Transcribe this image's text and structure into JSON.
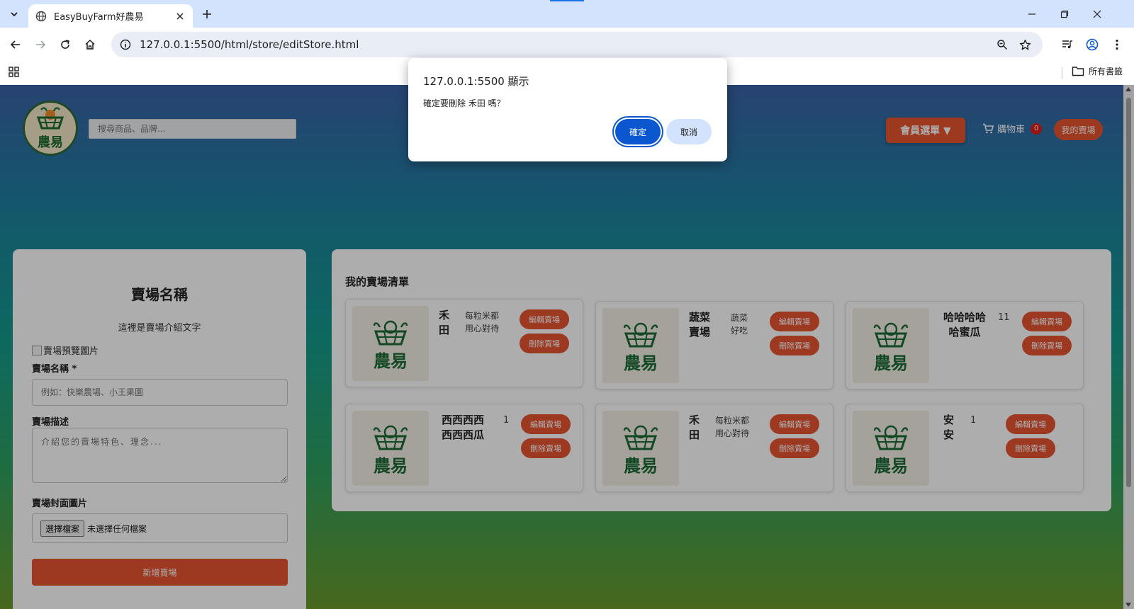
{
  "browser": {
    "tab_title": "EasyBuyFarm好農易",
    "url": "127.0.0.1:5500/html/store/editStore.html",
    "bookmark_folder": "所有書籤"
  },
  "header": {
    "logo_text": "農易",
    "search_placeholder": "搜尋商品、品牌...",
    "member_menu_label": "會員選單 ▼",
    "cart_label": "購物車",
    "cart_count": "0",
    "my_store_label": "我的賣場"
  },
  "form": {
    "title": "賣場名稱",
    "description": "這裡是賣場介紹文字",
    "preview_alt": "賣場預覽圖片",
    "name_label": "賣場名稱 *",
    "name_placeholder": "例如：快樂農場、小王果園",
    "desc_label": "賣場描述",
    "desc_placeholder": "介紹您的賣場特色、理念...",
    "cover_label": "賣場封面圖片",
    "file_button": "選擇檔案",
    "file_status": "未選擇任何檔案",
    "submit_label": "新增賣場"
  },
  "store_list": {
    "title": "我的賣場清單",
    "edit_label": "編輯賣場",
    "delete_label": "刪除賣場",
    "logo_text": "農易",
    "stores": [
      {
        "name": "禾\n田",
        "desc": "每粒米都\n用心對待"
      },
      {
        "name": "蔬菜\n賣場",
        "desc": "蔬菜\n好吃"
      },
      {
        "name": "哈哈哈哈\n哈蜜瓜",
        "desc": "11"
      },
      {
        "name": "西西西西\n西西西瓜",
        "desc": "1"
      },
      {
        "name": "禾\n田",
        "desc": "每粒米都\n用心對待"
      },
      {
        "name": "安\n安",
        "desc": "1"
      }
    ]
  },
  "dialog": {
    "title": "127.0.0.1:5500 顯示",
    "message": "確定要刪除 禾田 嗎？",
    "ok_label": "確定",
    "cancel_label": "取消"
  },
  "colors": {
    "accent_orange": "#e85431",
    "dialog_primary": "#0b57d0",
    "logo_green": "#1b6a35"
  }
}
